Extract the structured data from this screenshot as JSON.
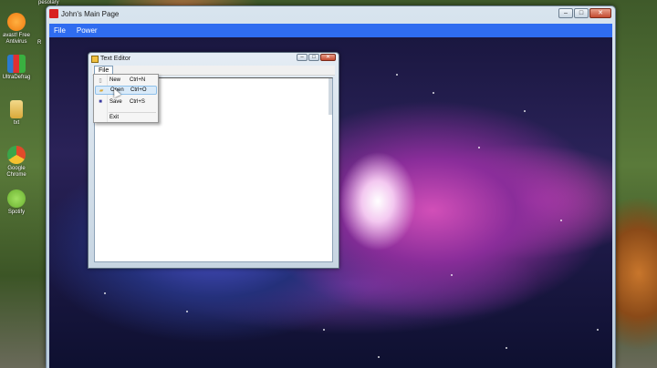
{
  "desktop": {
    "top_label": "pesolary",
    "right_label": "R",
    "icons": [
      {
        "label_line1": "avast! Free",
        "label_line2": "Antivirus",
        "icon": "avast-icon",
        "color": "#f07a10"
      },
      {
        "label_line1": "UltraDefrag",
        "label_line2": "",
        "icon": "ultradefrag-icon",
        "color": "#2a7ad0"
      },
      {
        "label_line1": "txt",
        "label_line2": "",
        "icon": "folder-icon",
        "color": "#e8c45a"
      },
      {
        "label_line1": "Google",
        "label_line2": "Chrome",
        "icon": "chrome-icon",
        "color": "#e04a2a"
      },
      {
        "label_line1": "Spotify",
        "label_line2": "",
        "icon": "spotify-icon",
        "color": "#7ac43a"
      }
    ]
  },
  "main_window": {
    "title": "John's Main Page",
    "menu": [
      "File",
      "Power"
    ],
    "menubar_color": "#2f6cf0",
    "buttons": {
      "minimize": "–",
      "maximize": "□",
      "close": "✕"
    }
  },
  "editor": {
    "title": "Text Editor",
    "menu_file": "File",
    "buttons": {
      "minimize": "–",
      "maximize": "□",
      "close": "✕"
    }
  },
  "file_menu": {
    "items": [
      {
        "label": "New",
        "shortcut": "Ctrl+N",
        "icon": "new-document-icon",
        "glyph": "▯"
      },
      {
        "label": "Open",
        "shortcut": "Ctrl+O",
        "icon": "open-folder-icon",
        "glyph": "▰"
      },
      {
        "label": "Save",
        "shortcut": "Ctrl+S",
        "icon": "save-disk-icon",
        "glyph": "■"
      }
    ],
    "exit": {
      "label": "Exit"
    }
  }
}
